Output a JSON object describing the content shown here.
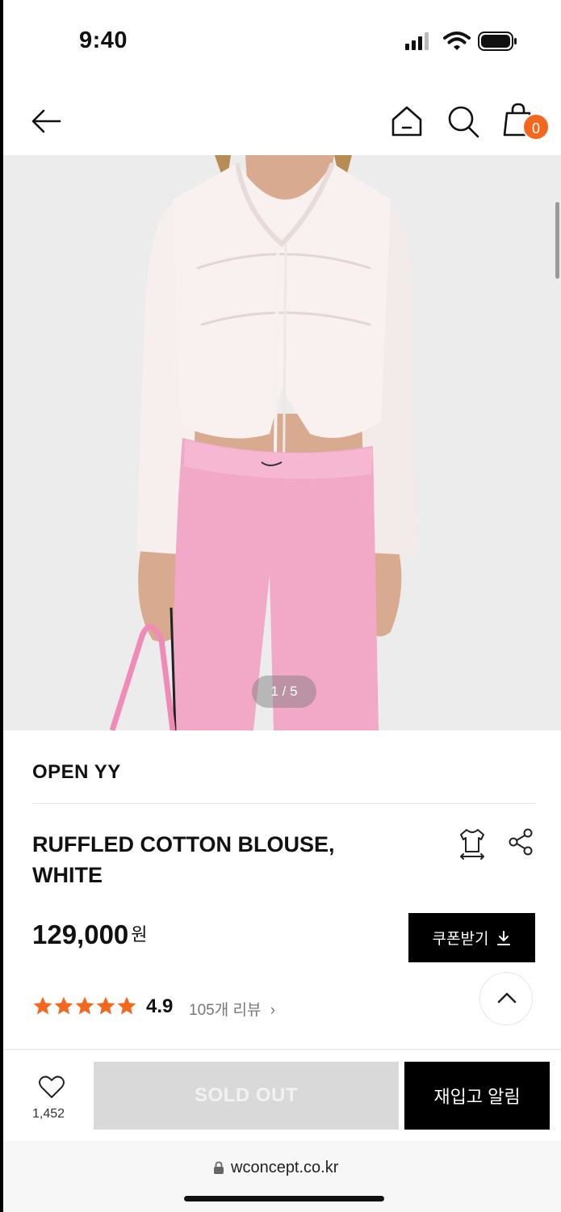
{
  "status": {
    "time": "9:40"
  },
  "nav": {
    "cart_count": "0"
  },
  "gallery": {
    "pager": "1 / 5"
  },
  "product": {
    "brand": "OPEN YY",
    "title": "RUFFLED COTTON BLOUSE, WHITE",
    "price": "129,000",
    "currency": "원",
    "coupon_label": "쿠폰받기",
    "rating": "4.9",
    "stars": 5,
    "reviews_label": "105개 리뷰",
    "reviews_chevron": "›"
  },
  "bottom": {
    "like_count": "1,452",
    "soldout_label": "SOLD OUT",
    "restock_label": "재입고 알림"
  },
  "browser": {
    "url": "wconcept.co.kr"
  },
  "colors": {
    "accent": "#f4671f",
    "black": "#000000",
    "soldout_bg": "#d9d9d9"
  }
}
